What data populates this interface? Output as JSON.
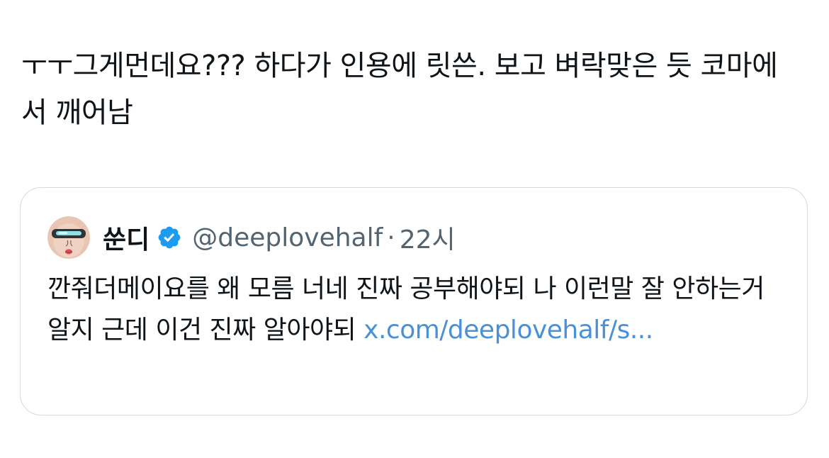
{
  "tweet": {
    "text": "ㅜㅜ그게먼데요??? 하다가 인용에 릿쓴. 보고 벼락맞은 듯 코마에서 깨어남"
  },
  "quote": {
    "display_name": "쑨디",
    "handle": "@deeplovehalf",
    "separator": "·",
    "time": "22시",
    "body_text": "깐줘더메이요를 왜 모름 너네 진짜 공부해야되 나 이런말 잘 안하는거알지 근데 이건 진짜 알아야되 ",
    "link_text": "x.com/deeplovehalf/s...",
    "verified_icon": "verified-badge-icon"
  },
  "colors": {
    "text": "#0f1419",
    "secondary": "#536471",
    "link": "#4a90d9",
    "verified": "#1d9bf0",
    "border": "#d5dade"
  }
}
